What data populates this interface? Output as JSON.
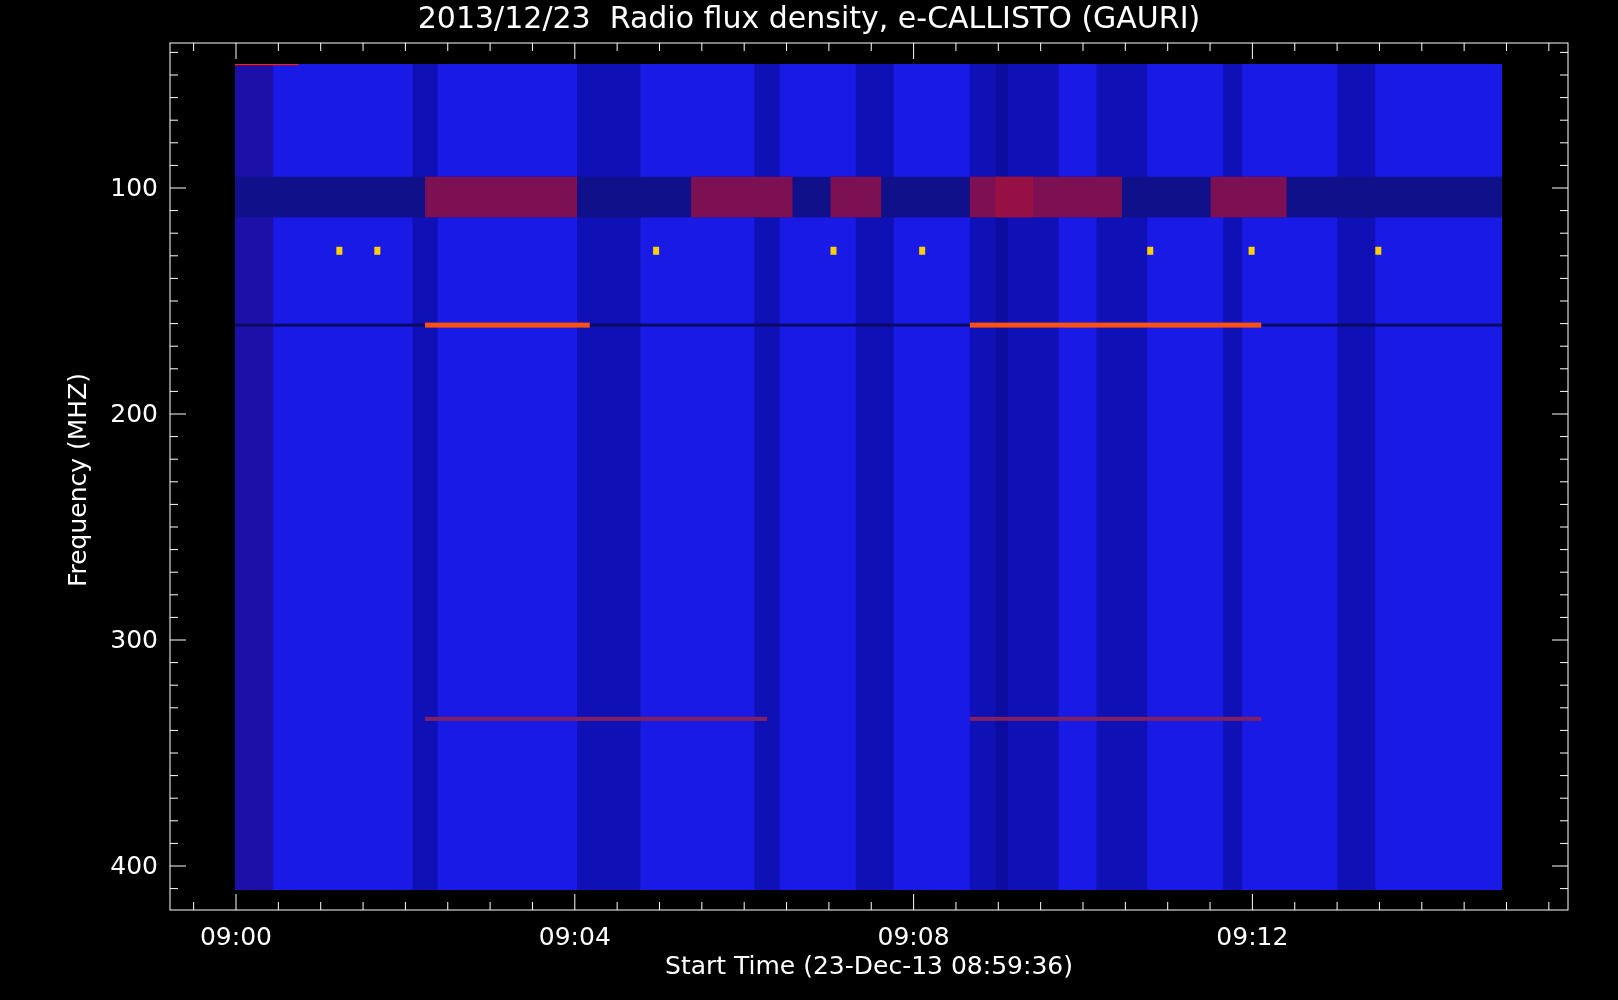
{
  "title": "2013/12/23  Radio flux density, e-CALLISTO (GAURI)",
  "y_axis": {
    "label": "Frequency (MHZ)",
    "ticks": [
      "100",
      "200",
      "300",
      "400"
    ]
  },
  "x_axis": {
    "label": "Start Time (23-Dec-13 08:59:36)",
    "ticks": [
      "09:00",
      "09:04",
      "09:08",
      "09:12"
    ]
  }
}
